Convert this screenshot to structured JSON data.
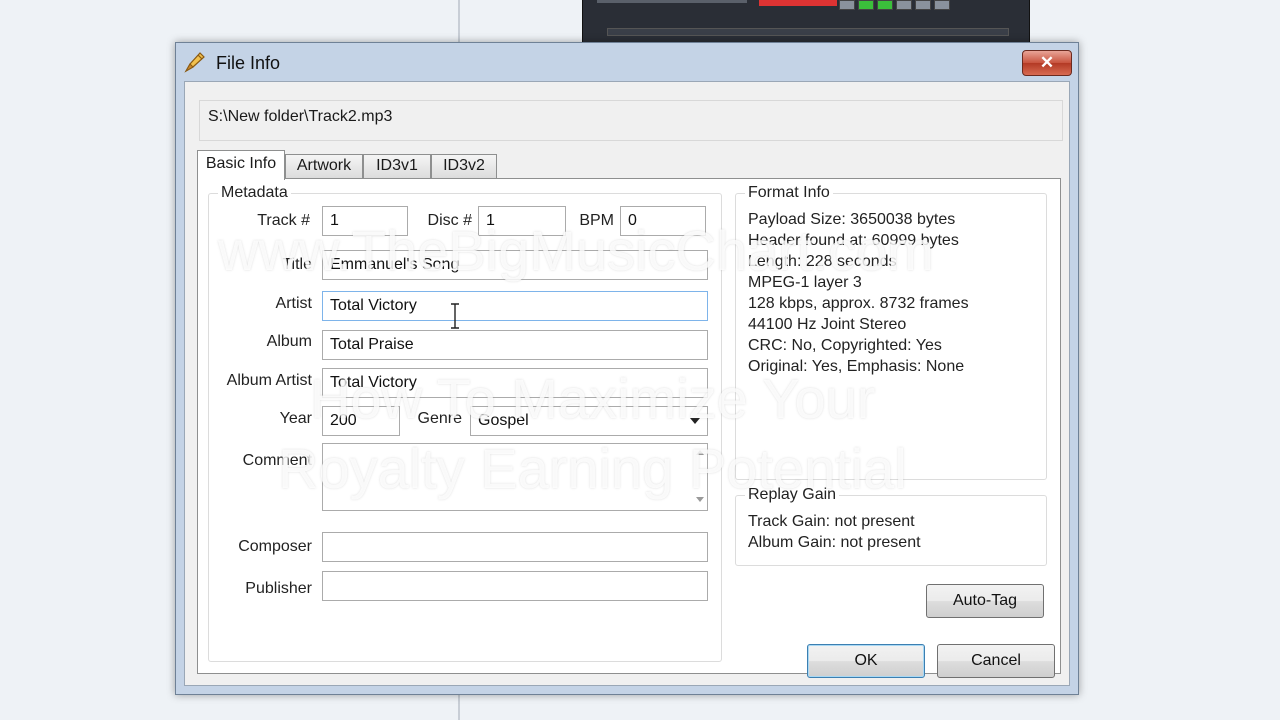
{
  "window": {
    "title": "File Info",
    "close_label": "✕"
  },
  "file_path": "S:\\New folder\\Track2.mp3",
  "tabs": [
    {
      "label": "Basic Info",
      "active": true
    },
    {
      "label": "Artwork"
    },
    {
      "label": "ID3v1"
    },
    {
      "label": "ID3v2"
    }
  ],
  "metadata": {
    "legend": "Metadata",
    "track_label": "Track #",
    "track_value": "1",
    "disc_label": "Disc #",
    "disc_value": "1",
    "bpm_label": "BPM",
    "bpm_value": "0",
    "title_label": "Title",
    "title_value": "Emmanuel's Song",
    "artist_label": "Artist",
    "artist_value": "Total Victory",
    "album_label": "Album",
    "album_value": "Total Praise",
    "album_artist_label": "Album Artist",
    "album_artist_value": "Total Victory",
    "year_label": "Year",
    "year_value": "200",
    "genre_label": "Genre",
    "genre_value": "Gospel",
    "comment_label": "Comment",
    "comment_value": "",
    "composer_label": "Composer",
    "composer_value": "",
    "publisher_label": "Publisher",
    "publisher_value": ""
  },
  "format_info": {
    "legend": "Format Info",
    "lines": [
      "Payload Size: 3650038 bytes",
      "Header found at: 60999 bytes",
      "Length: 228 seconds",
      "MPEG-1 layer 3",
      "128 kbps, approx. 8732 frames",
      "44100 Hz Joint Stereo",
      "CRC: No, Copyrighted: Yes",
      "Original: Yes, Emphasis: None"
    ]
  },
  "replay_gain": {
    "legend": "Replay Gain",
    "lines": [
      "Track Gain: not present",
      "Album Gain: not present"
    ]
  },
  "buttons": {
    "auto_tag": "Auto-Tag",
    "ok": "OK",
    "cancel": "Cancel"
  },
  "watermark": {
    "line1": "www.TheBigMusicChart.com",
    "line2": "How To Maximize Your",
    "line3": "Royalty Earning Potential"
  }
}
